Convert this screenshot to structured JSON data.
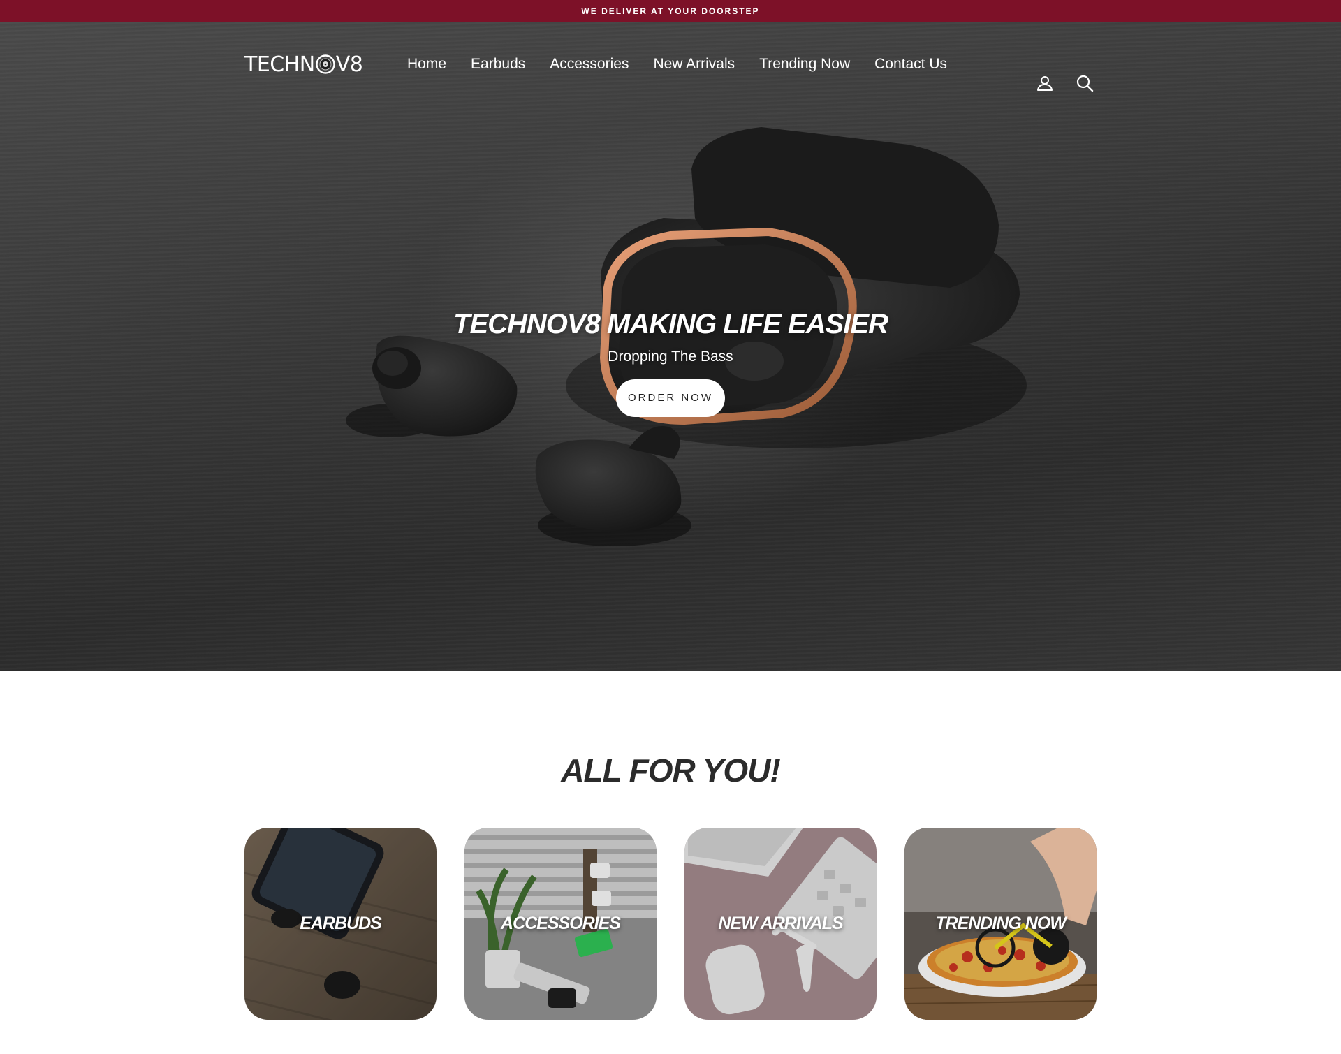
{
  "announcement": {
    "text": "WE DELIVER AT YOUR DOORSTEP"
  },
  "brand": {
    "logo_text_left": "TECHN",
    "logo_text_right": "V8",
    "accent": "#7d1128"
  },
  "nav": {
    "items": [
      {
        "label": "Home"
      },
      {
        "label": "Earbuds"
      },
      {
        "label": "Accessories"
      },
      {
        "label": "New Arrivals"
      },
      {
        "label": "Trending Now"
      },
      {
        "label": "Contact Us"
      }
    ]
  },
  "header_icons": {
    "account": "user-icon",
    "search": "search-icon"
  },
  "hero": {
    "title": "TECHNOV8 MAKING LIFE EASIER",
    "subtitle": "Dropping The Bass",
    "cta_label": "ORDER NOW"
  },
  "collections": {
    "title": "ALL FOR YOU!",
    "tiles": [
      {
        "label": "EARBUDS"
      },
      {
        "label": "ACCESSORIES"
      },
      {
        "label": "NEW ARRIVALS"
      },
      {
        "label": "TRENDING NOW"
      }
    ]
  }
}
